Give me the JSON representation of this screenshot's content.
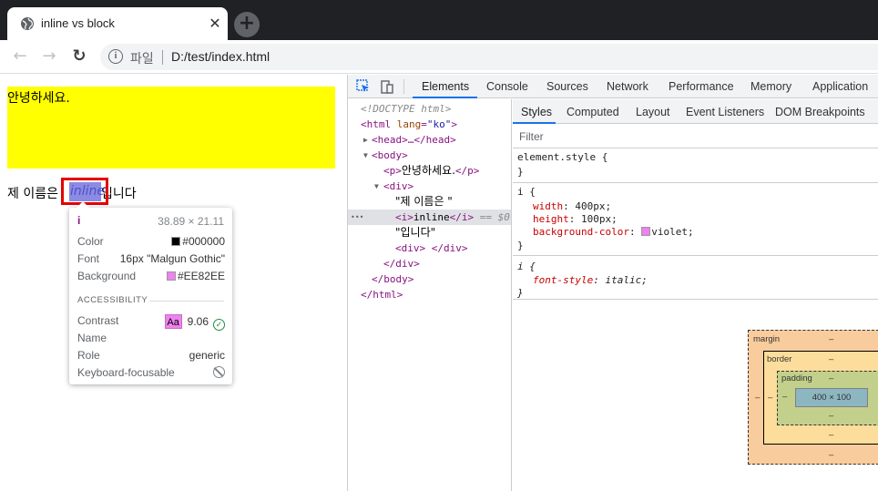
{
  "browser": {
    "tab_title": "inline vs block",
    "tab_close": "✕",
    "new_tab": "+",
    "scheme_label": "파일",
    "url": "D:/test/index.html",
    "back": "←",
    "forward": "→",
    "reload": "↻"
  },
  "page": {
    "paragraph": "안녕하세요.",
    "line_prefix": "제 이름은",
    "inline_word": "inline",
    "line_suffix": "입니다"
  },
  "tooltip": {
    "tag": "i",
    "dimensions": "38.89 × 21.11",
    "color_label": "Color",
    "color_value": "#000000",
    "font_label": "Font",
    "font_value": "16px \"Malgun Gothic\"",
    "background_label": "Background",
    "background_value": "#EE82EE",
    "accessibility_heading": "ACCESSIBILITY",
    "contrast_label": "Contrast",
    "contrast_badge": "Aa",
    "contrast_value": "9.06",
    "name_label": "Name",
    "role_label": "Role",
    "role_value": "generic",
    "keyboard_label": "Keyboard-focusable"
  },
  "devtools": {
    "tabs": [
      "Elements",
      "Console",
      "Sources",
      "Network",
      "Performance",
      "Memory",
      "Application"
    ],
    "active_tab": "Elements",
    "sidebar_tabs": [
      "Styles",
      "Computed",
      "Layout",
      "Event Listeners",
      "DOM Breakpoints"
    ],
    "active_sidebar_tab": "Styles",
    "filter_placeholder": "Filter",
    "dom": {
      "doctype": "<!DOCTYPE html>",
      "html_open_tag": "<html",
      "html_attr_name": "lang",
      "html_attr_value": "\"ko\"",
      "head": "<head>…</head>",
      "body_open": "<body>",
      "p_open": "<p>",
      "p_text": "안녕하세요.",
      "p_close": "</p>",
      "div_open": "<div>",
      "text1": "\"제 이름은 \"",
      "i_open": "<i>",
      "i_text": "inline",
      "i_close": "</i>",
      "selected_marker": "== $0",
      "text2": "\"입니다\"",
      "div_empty": "<div> </div>",
      "div_close": "</div>",
      "body_close": "</body>",
      "html_close": "</html>",
      "dots": "•••"
    },
    "styles": {
      "element_style": "element.style {",
      "close_brace": "}",
      "rule1_selector": "i {",
      "rule1_props": [
        {
          "name": "width",
          "value": "400px;"
        },
        {
          "name": "height",
          "value": "100px;"
        },
        {
          "name": "background-color",
          "value": "violet;"
        }
      ],
      "rule2_selector": "i {",
      "rule2_props": [
        {
          "name": "font-style",
          "value": "italic;"
        }
      ]
    },
    "box_model": {
      "margin_label": "margin",
      "border_label": "border",
      "padding_label": "padding",
      "content_size": "400 × 100",
      "dash": "–"
    }
  },
  "colors": {
    "yellow": "#ffff00",
    "violet": "#ee82ee",
    "highlight": "#8b8be4",
    "selection_border": "#e30000",
    "devtools_blue": "#1a73e8"
  }
}
